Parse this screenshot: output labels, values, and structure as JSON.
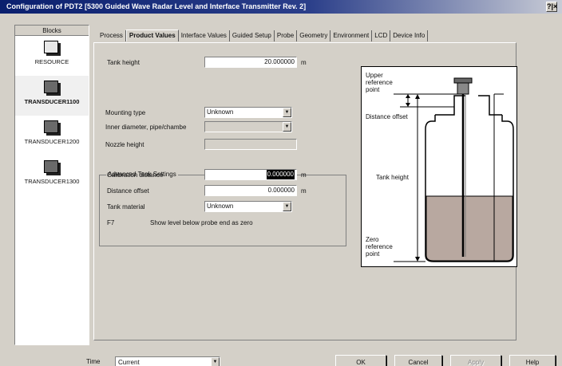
{
  "window": {
    "title": "Configuration of PDT2 [5300 Guided Wave Radar Level and Interface Transmitter Rev. 2]",
    "help_glyph": "?|×"
  },
  "blocks": {
    "header": "Blocks",
    "items": [
      {
        "label": "RESOURCE"
      },
      {
        "label": "TRANSDUCER1100"
      },
      {
        "label": "TRANSDUCER1200"
      },
      {
        "label": "TRANSDUCER1300"
      }
    ],
    "selected_index": 1
  },
  "tabs": [
    "Process",
    "Product Values",
    "Interface Values",
    "Guided Setup",
    "Probe",
    "Geometry",
    "Environment",
    "LCD",
    "Device Info"
  ],
  "active_tab": "Product Values",
  "form": {
    "tank_height": {
      "label": "Tank height",
      "value": "20.000000",
      "unit": "m"
    },
    "mounting_type": {
      "label": "Mounting type",
      "value": "Unknown"
    },
    "inner_diameter": {
      "label": "Inner diameter, pipe/chambe",
      "value": ""
    },
    "nozzle_height": {
      "label": "Nozzle height",
      "value": ""
    },
    "advanced": {
      "title": "Advanced Tank Settings",
      "calibration_distance": {
        "label": "Calibration distance",
        "value": "0.000000",
        "unit": "m"
      },
      "distance_offset": {
        "label": "Distance offset",
        "value": "0.000000",
        "unit": "m"
      },
      "tank_material": {
        "label": "Tank material",
        "value": "Unknown"
      },
      "show_level": {
        "checkbox": "F7",
        "label": "Show level below probe end as zero"
      }
    }
  },
  "diagram": {
    "upper_reference_point": "Upper reference point",
    "distance_offset": "Distance offset",
    "tank_height": "Tank height",
    "zero_reference_point": "Zero reference point",
    "colors": {
      "liquid": "#b8a8a0",
      "outline": "#000000"
    }
  },
  "footer": {
    "time_label": "Time",
    "time_value": "Current",
    "ok": "OK",
    "cancel": "Cancel",
    "apply": "Apply",
    "help": "Help"
  }
}
